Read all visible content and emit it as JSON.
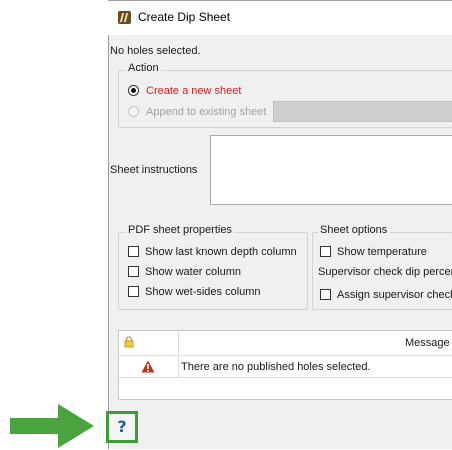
{
  "dialog": {
    "title": "Create Dip Sheet",
    "status": "No holes selected."
  },
  "action": {
    "label": "Action",
    "create_new": "Create a new sheet",
    "append_existing": "Append to existing sheet"
  },
  "instructions": {
    "label": "Sheet instructions"
  },
  "pdf_props": {
    "label": "PDF sheet properties",
    "show_last_depth": "Show last known depth column",
    "show_water": "Show water column",
    "show_wet_sides": "Show wet-sides column"
  },
  "sheet_options": {
    "label": "Sheet options",
    "show_temperature": "Show temperature",
    "supervisor_percent": "Supervisor check dip percer",
    "assign_supervisor": "Assign supervisor check"
  },
  "messages": {
    "header_icon": "lock-icon",
    "header_message": "Message",
    "rows": [
      {
        "icon": "warning-icon",
        "text": "There are no published holes selected."
      }
    ]
  },
  "help": {
    "label": "?"
  },
  "colors": {
    "highlight_green": "#4aa33f",
    "selected_red": "#d81e1e"
  }
}
